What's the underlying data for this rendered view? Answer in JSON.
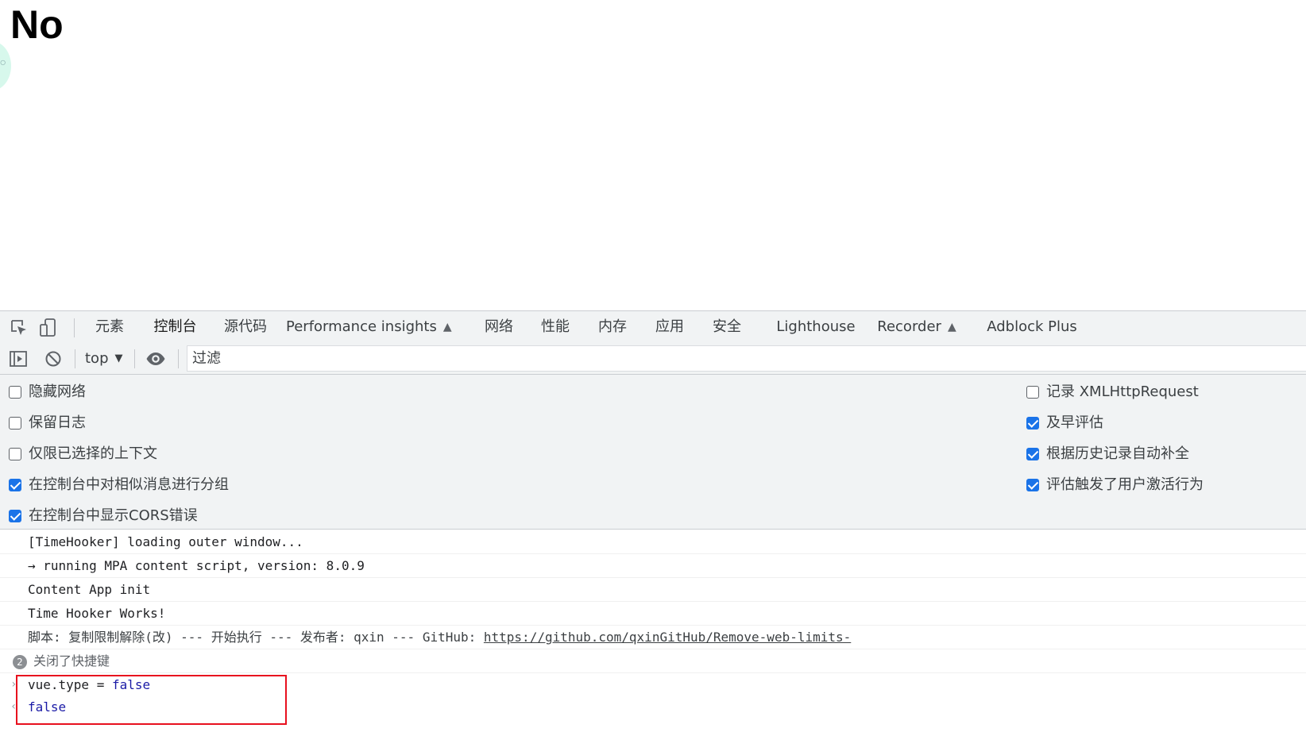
{
  "page": {
    "heading": "No"
  },
  "devtools": {
    "tabs": [
      {
        "label": "元素"
      },
      {
        "label": "控制台"
      },
      {
        "label": "源代码"
      },
      {
        "label": "Performance insights",
        "icon": "flask-icon"
      },
      {
        "label": "网络"
      },
      {
        "label": "性能"
      },
      {
        "label": "内存"
      },
      {
        "label": "应用"
      },
      {
        "label": "安全"
      },
      {
        "label": "Lighthouse"
      },
      {
        "label": "Recorder",
        "icon": "flask-icon"
      },
      {
        "label": "Adblock Plus"
      }
    ],
    "active_tab": "控制台",
    "toolbar": {
      "context": "top",
      "filter_placeholder": "过滤"
    },
    "settings": {
      "left": [
        {
          "label": "隐藏网络",
          "checked": false
        },
        {
          "label": "保留日志",
          "checked": false
        },
        {
          "label": "仅限已选择的上下文",
          "checked": false
        },
        {
          "label": "在控制台中对相似消息进行分组",
          "checked": true
        },
        {
          "label": "在控制台中显示CORS错误",
          "checked": true
        }
      ],
      "right": [
        {
          "label": "记录 XMLHttpRequest",
          "checked": false
        },
        {
          "label": "及早评估",
          "checked": true
        },
        {
          "label": "根据历史记录自动补全",
          "checked": true
        },
        {
          "label": "评估触发了用户激活行为",
          "checked": true
        }
      ]
    },
    "console": {
      "messages": [
        {
          "text": "[TimeHooker] loading outer window..."
        },
        {
          "text": "→ running MPA content script, version: 8.0.9"
        },
        {
          "text": "Content App init"
        },
        {
          "text": "Time Hooker Works!"
        },
        {
          "text": "脚本: 复制限制解除(改) --- 开始执行 --- 发布者: qxin --- GitHub: ",
          "link": "https://github.com/qxinGitHub/Remove-web-limits-"
        },
        {
          "text": "关闭了快捷键",
          "count": "2"
        }
      ],
      "input": {
        "expr": "vue.type = ",
        "value": "false"
      },
      "result": "false"
    },
    "accent_color": "#1a73e8",
    "highlight_color": "#e8101e"
  }
}
